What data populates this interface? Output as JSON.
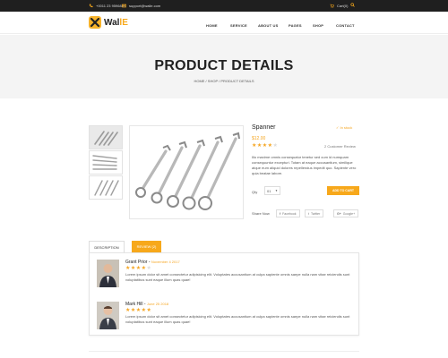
{
  "topbar": {
    "phone": "+0011 23 9596881",
    "email": "support@walle.com",
    "cart": "Cart(0)"
  },
  "brand": {
    "name_prefix": "Wal",
    "name_suffix": "lE"
  },
  "nav": [
    "HOME",
    "SERVICE",
    "ABOUT US",
    "PAGES",
    "SHOP",
    "CONTACT"
  ],
  "hero": {
    "title": "PRODUCT DETAILS",
    "breadcrumb": "HOME / SHOP / PRODUCT DETAILS"
  },
  "product": {
    "name": "Spanner",
    "stock": "In stock",
    "price": "$12.00",
    "rating": 4,
    "max_rating": 5,
    "review_count": "2 Customer Review",
    "description": "Illo maxime omnis consequatur tenetur sed cum id numquam consequuntur excepturi. Totam at eaque accusantium, similique atque eum aliquid dolores repellendus impedit quo. Sapiente vero quia beatae labore.",
    "qty_label": "Qty",
    "qty_value": "01",
    "add_to_cart": "ADD TO CART",
    "share_label": "Share Now",
    "share": [
      "Facebook",
      "Twitter",
      "Google+"
    ]
  },
  "tabs": {
    "description": "DESCRIPTION",
    "reviews": "REVIEW (2)"
  },
  "reviews": [
    {
      "name": "Grant Prior",
      "separator": " - ",
      "date": "November 4 2017",
      "rating": 4,
      "text": "Lorem ipsum dolor sit amet consectetur adipisicing elit. Voluptates accusantium at culpa sapiente omnis saepe nulla nam vitae reiciendis sunt voluptatibus sunt eaque illum quas quae!"
    },
    {
      "name": "Mark Hill",
      "separator": " - ",
      "date": "June 25 2018",
      "rating": 5,
      "text": "Lorem ipsum dolor sit amet consectetur adipisicing elit. Voluptates accusantium at culpa sapiente omnis saepe nulla nam vitae reiciendis sunt voluptatibus sunt eaque illum quas quae!"
    }
  ],
  "colors": {
    "accent": "#f7a81b",
    "topbar": "#1f1f1f",
    "hero_bg": "#f4f4f4"
  },
  "icons": [
    "phone-icon",
    "mail-icon",
    "cart-icon",
    "search-icon",
    "facebook-icon",
    "twitter-icon",
    "google-plus-icon"
  ]
}
